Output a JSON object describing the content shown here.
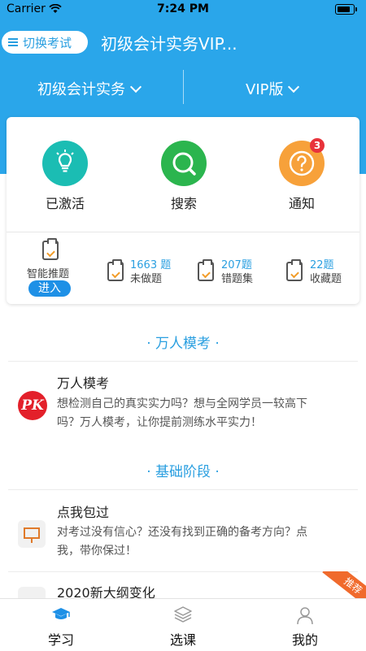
{
  "status_bar": {
    "carrier": "Carrier",
    "time": "7:24 PM"
  },
  "header": {
    "switch_button": "切换考试",
    "title": "初级会计实务VIP...",
    "subject_selector": "初级会计实务",
    "edition_selector": "VIP版"
  },
  "quick_actions": [
    {
      "label": "已激活",
      "icon": "lightbulb-icon",
      "color": "#1bbdb3"
    },
    {
      "label": "搜索",
      "icon": "search-icon",
      "color": "#2bb54e"
    },
    {
      "label": "通知",
      "icon": "question-icon",
      "color": "#f7a13a",
      "badge": "3"
    }
  ],
  "practice": {
    "smart": {
      "label": "智能推题",
      "button": "进入"
    },
    "stats": [
      {
        "count": "1663 题",
        "label": "未做题"
      },
      {
        "count": "207题",
        "label": "错题集"
      },
      {
        "count": "22题",
        "label": "收藏题"
      }
    ]
  },
  "sections": [
    {
      "title": "万人模考",
      "item": {
        "title": "万人模考",
        "description": "想检测自己的真实实力吗？想与全网学员一较高下吗？万人模考，让你提前测练水平实力！",
        "icon_text": "PK"
      }
    },
    {
      "title": "基础阶段",
      "item": {
        "title": "点我包过",
        "description": "对考过没有信心？还没有找到正确的备考方向？点我，带你保过！"
      },
      "next_item": {
        "title": "2020新大纲变化",
        "ribbon": "推荐"
      }
    }
  ],
  "tab_bar": [
    {
      "label": "学习",
      "active": true
    },
    {
      "label": "选课",
      "active": false
    },
    {
      "label": "我的",
      "active": false
    }
  ],
  "colors": {
    "primary": "#2aa6ea",
    "accent": "#1e90e6",
    "badge": "#e8323a"
  }
}
